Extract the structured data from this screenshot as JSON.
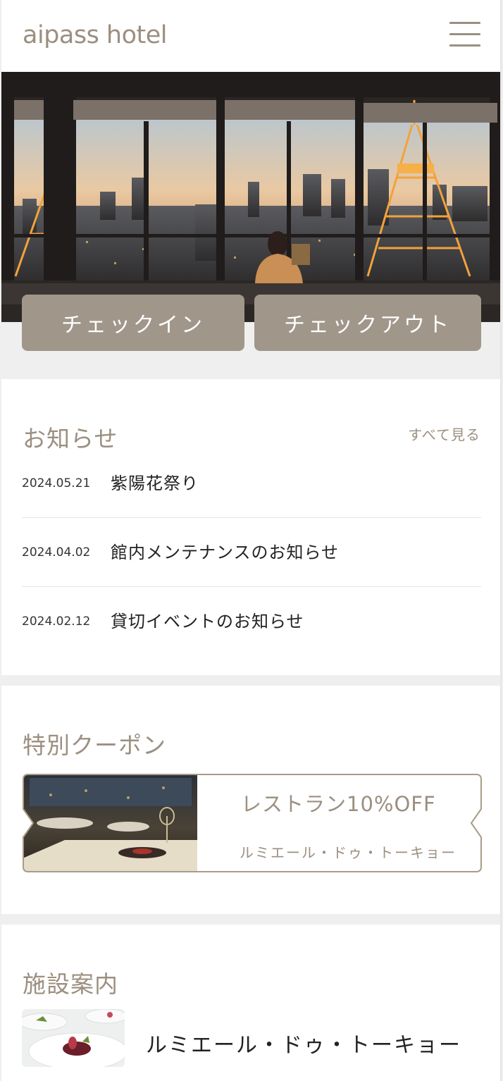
{
  "header": {
    "logo": "aipass hotel",
    "menu_icon": "hamburger-menu-icon"
  },
  "actions": {
    "checkin_label": "チェックイン",
    "checkout_label": "チェックアウト"
  },
  "news": {
    "title": "お知らせ",
    "see_all_label": "すべて見る",
    "items": [
      {
        "date": "2024.05.21",
        "title": "紫陽花祭り"
      },
      {
        "date": "2024.04.02",
        "title": "館内メンテナンスのお知らせ"
      },
      {
        "date": "2024.02.12",
        "title": "貸切イベントのお知らせ"
      }
    ]
  },
  "coupon": {
    "title": "特別クーポン",
    "items": [
      {
        "title": "レストラン10%OFF",
        "venue": "ルミエール・ドゥ・トーキョー"
      }
    ]
  },
  "facility": {
    "title": "施設案内",
    "items": [
      {
        "name": "ルミエール・ドゥ・トーキョー"
      }
    ]
  },
  "colors": {
    "accent": "#9b8f80",
    "button_bg": "#a0968a",
    "background": "#efefef"
  }
}
